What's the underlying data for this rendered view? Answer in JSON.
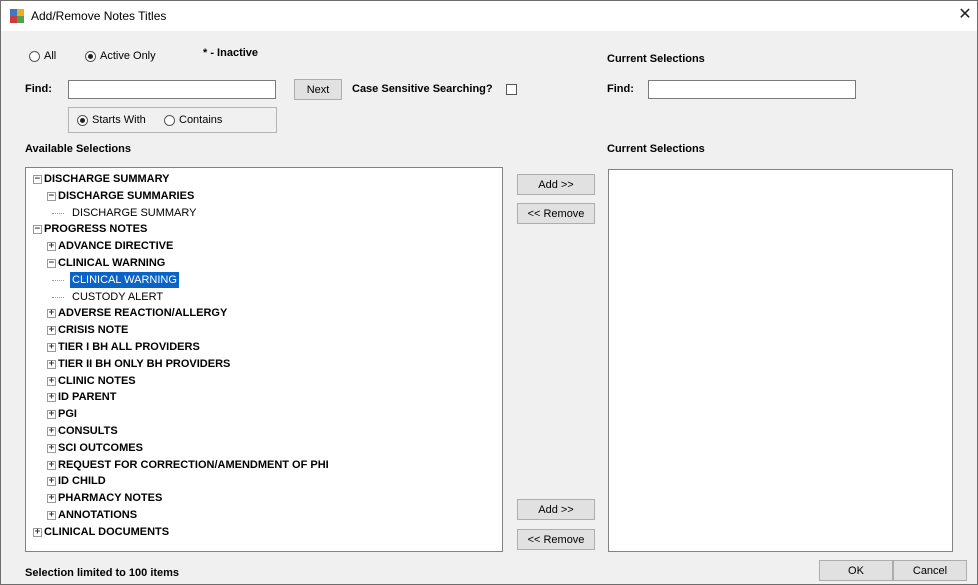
{
  "window": {
    "title": "Add/Remove Notes Titles",
    "close_glyph": "✕"
  },
  "filter": {
    "all_label": "All",
    "active_only_label": "Active Only",
    "inactive_marker": "* - Inactive",
    "selected": "Active Only"
  },
  "find": {
    "label": "Find:",
    "value": "",
    "next_label": "Next",
    "case_sensitive_label": "Case Sensitive Searching?",
    "case_sensitive_checked": false,
    "starts_with_label": "Starts With",
    "contains_label": "Contains",
    "mode": "Starts With"
  },
  "current_find": {
    "header": "Current Selections",
    "label": "Find:",
    "value": ""
  },
  "available": {
    "header": "Available Selections",
    "tree": [
      {
        "label": "DISCHARGE SUMMARY",
        "level": 0,
        "bold": true,
        "expander": "−"
      },
      {
        "label": "DISCHARGE SUMMARIES",
        "level": 1,
        "bold": true,
        "expander": "−"
      },
      {
        "label": "DISCHARGE SUMMARY",
        "level": 2,
        "bold": false,
        "expander": ""
      },
      {
        "label": "PROGRESS NOTES",
        "level": 0,
        "bold": true,
        "expander": "−"
      },
      {
        "label": "ADVANCE DIRECTIVE",
        "level": 1,
        "bold": true,
        "expander": "+"
      },
      {
        "label": "CLINICAL WARNING",
        "level": 1,
        "bold": true,
        "expander": "−"
      },
      {
        "label": "CLINICAL WARNING",
        "level": 2,
        "bold": false,
        "expander": "",
        "selected": true
      },
      {
        "label": "CUSTODY ALERT",
        "level": 2,
        "bold": false,
        "expander": ""
      },
      {
        "label": "ADVERSE REACTION/ALLERGY",
        "level": 1,
        "bold": true,
        "expander": "+"
      },
      {
        "label": "CRISIS NOTE",
        "level": 1,
        "bold": true,
        "expander": "+"
      },
      {
        "label": "TIER I BH ALL PROVIDERS",
        "level": 1,
        "bold": true,
        "expander": "+"
      },
      {
        "label": "TIER II BH ONLY BH PROVIDERS",
        "level": 1,
        "bold": true,
        "expander": "+"
      },
      {
        "label": "CLINIC NOTES",
        "level": 1,
        "bold": true,
        "expander": "+"
      },
      {
        "label": "ID PARENT",
        "level": 1,
        "bold": true,
        "expander": "+"
      },
      {
        "label": "PGI",
        "level": 1,
        "bold": true,
        "expander": "+"
      },
      {
        "label": "CONSULTS",
        "level": 1,
        "bold": true,
        "expander": "+"
      },
      {
        "label": "SCI OUTCOMES",
        "level": 1,
        "bold": true,
        "expander": "+"
      },
      {
        "label": "REQUEST FOR CORRECTION/AMENDMENT OF PHI",
        "level": 1,
        "bold": true,
        "expander": "+"
      },
      {
        "label": "ID CHILD",
        "level": 1,
        "bold": true,
        "expander": "+"
      },
      {
        "label": "PHARMACY NOTES",
        "level": 1,
        "bold": true,
        "expander": "+"
      },
      {
        "label": "ANNOTATIONS",
        "level": 1,
        "bold": true,
        "expander": "+"
      },
      {
        "label": "CLINICAL DOCUMENTS",
        "level": 0,
        "bold": true,
        "expander": "+"
      }
    ]
  },
  "actions": {
    "add_label": "Add >>",
    "remove_label": "<< Remove"
  },
  "current": {
    "header": "Current Selections",
    "items": []
  },
  "footer": {
    "limit_text": "Selection limited to 100 items",
    "ok_label": "OK",
    "cancel_label": "Cancel"
  }
}
